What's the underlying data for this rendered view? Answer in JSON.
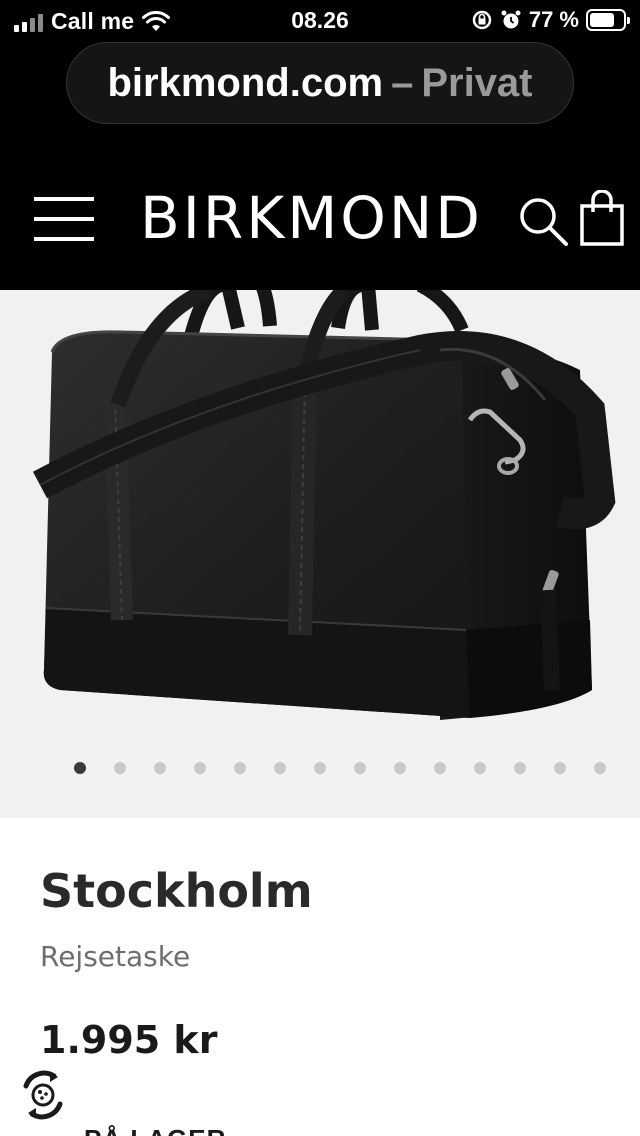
{
  "status_bar": {
    "carrier": "Call me",
    "time": "08.26",
    "battery": "77 %",
    "battery_level": 0.77
  },
  "browser": {
    "domain": "birkmond.com",
    "separator": "–",
    "mode": "Privat"
  },
  "header": {
    "brand": "BIRKMOND",
    "icons": [
      "hamburger-menu-icon",
      "search-icon",
      "shopping-bag-icon"
    ]
  },
  "gallery": {
    "dot_count": 14,
    "active_index": 0,
    "background": "#f1f1f1"
  },
  "product": {
    "title": "Stockholm",
    "subtitle": "Rejsetaske",
    "price": "1.995 kr",
    "stock": "PÅ LAGER"
  },
  "colors": {
    "header_bg": "#000000",
    "text_primary": "#2a2a2a",
    "text_secondary": "#6e6e6e"
  }
}
